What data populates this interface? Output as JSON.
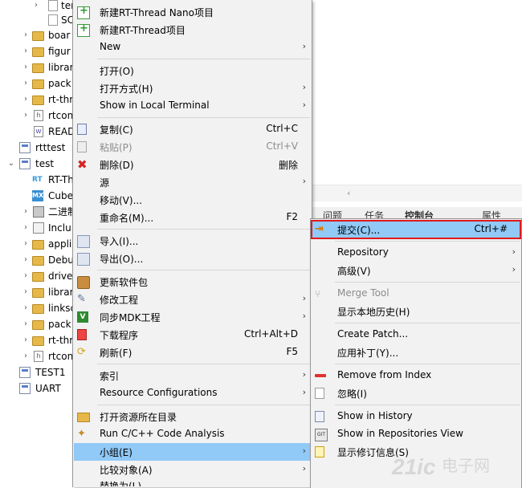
{
  "tree": {
    "items": [
      {
        "label": "ter",
        "icon": "c-source-file-icon"
      },
      {
        "label": "SC",
        "icon": "file-icon"
      },
      {
        "label": "boar",
        "icon": "folder-icon"
      },
      {
        "label": "figur",
        "icon": "folder-icon"
      },
      {
        "label": "librar",
        "icon": "folder-icon"
      },
      {
        "label": "pack",
        "icon": "folder-icon"
      },
      {
        "label": "rt-thr",
        "icon": "folder-icon"
      },
      {
        "label": "rtcon",
        "icon": "header-file-icon"
      },
      {
        "label": "READ",
        "icon": "readme-file-icon"
      },
      {
        "label": "rtttest",
        "icon": "project-icon"
      },
      {
        "label": "test",
        "icon": "project-icon"
      },
      {
        "label": "RT-Th",
        "icon": "rt-thread-icon"
      },
      {
        "label": "Cube",
        "icon": "cubemx-icon"
      },
      {
        "label": "二进制",
        "icon": "binaries-icon"
      },
      {
        "label": "Inclu",
        "icon": "includes-icon"
      },
      {
        "label": "appli",
        "icon": "folder-icon"
      },
      {
        "label": "Debu",
        "icon": "folder-icon"
      },
      {
        "label": "drive",
        "icon": "folder-icon"
      },
      {
        "label": "librar",
        "icon": "folder-icon"
      },
      {
        "label": "linksc",
        "icon": "folder-icon"
      },
      {
        "label": "pack",
        "icon": "folder-icon"
      },
      {
        "label": "rt-thr",
        "icon": "folder-icon"
      },
      {
        "label": "rtcon",
        "icon": "header-file-icon"
      },
      {
        "label": "TEST1",
        "icon": "project-icon"
      },
      {
        "label": "UART",
        "icon": "project-icon"
      }
    ]
  },
  "views": {
    "tabs": [
      "问题",
      "任务",
      "控制台",
      "属性"
    ]
  },
  "main_menu": {
    "items": [
      {
        "label": "新建RT-Thread Nano项目",
        "icon": "new-project-icon"
      },
      {
        "label": "新建RT-Thread项目",
        "icon": "new-project-icon"
      },
      {
        "label": "New",
        "submenu": "›"
      },
      {
        "label": "打开(O)"
      },
      {
        "label": "打开方式(H)",
        "submenu": "›"
      },
      {
        "label": "Show in Local Terminal",
        "submenu": "›"
      },
      {
        "label": "复制(C)",
        "shortcut": "Ctrl+C",
        "icon": "copy-icon"
      },
      {
        "label": "粘贴(P)",
        "shortcut": "Ctrl+V",
        "icon": "paste-icon"
      },
      {
        "label": "删除(D)",
        "shortcut": "删除",
        "icon": "delete-icon"
      },
      {
        "label": "源",
        "submenu": "›"
      },
      {
        "label": "移动(V)..."
      },
      {
        "label": "重命名(M)...",
        "shortcut": "F2"
      },
      {
        "label": "导入(I)...",
        "icon": "import-icon"
      },
      {
        "label": "导出(O)...",
        "icon": "export-icon"
      },
      {
        "label": "更新软件包",
        "icon": "package-icon"
      },
      {
        "label": "修改工程",
        "submenu": "›",
        "icon": "wrench-icon"
      },
      {
        "label": "同步MDK工程",
        "submenu": "›",
        "icon": "mdk-icon"
      },
      {
        "label": "下载程序",
        "shortcut": "Ctrl+Alt+D",
        "icon": "download-icon"
      },
      {
        "label": "刷新(F)",
        "shortcut": "F5",
        "icon": "refresh-icon"
      },
      {
        "label": "索引",
        "submenu": "›"
      },
      {
        "label": "Resource Configurations",
        "submenu": "›"
      },
      {
        "label": "打开资源所在目录",
        "icon": "folder-open-icon"
      },
      {
        "label": "Run C/C++ Code Analysis",
        "icon": "code-analysis-icon"
      },
      {
        "label": "小组(E)",
        "submenu": "›"
      },
      {
        "label": "比较对象(A)",
        "submenu": "›"
      },
      {
        "label": "替换为(L)"
      }
    ]
  },
  "sub_menu": {
    "items": [
      {
        "label": "提交(C)...",
        "shortcut": "Ctrl+#",
        "icon": "commit-icon"
      },
      {
        "label": "Repository",
        "submenu": "›"
      },
      {
        "label": "高级(V)",
        "submenu": "›"
      },
      {
        "label": "Merge Tool",
        "icon": "merge-tool-icon"
      },
      {
        "label": "显示本地历史(H)"
      },
      {
        "label": "Create Patch..."
      },
      {
        "label": "应用补丁(Y)..."
      },
      {
        "label": "Remove from Index",
        "icon": "remove-from-index-icon"
      },
      {
        "label": "忽略(I)",
        "icon": "ignore-icon"
      },
      {
        "label": "Show in History",
        "icon": "history-icon"
      },
      {
        "label": "Show in Repositories View",
        "icon": "git-repositories-icon"
      },
      {
        "label": "显示修订信息(S)",
        "icon": "revision-info-icon"
      }
    ]
  },
  "watermark": {
    "text": "21ic",
    "cn": "电子网"
  },
  "colors": {
    "highlight": "#91c9f7",
    "selection_border": "#e0191c",
    "menu_bg": "#f2f2f2"
  }
}
